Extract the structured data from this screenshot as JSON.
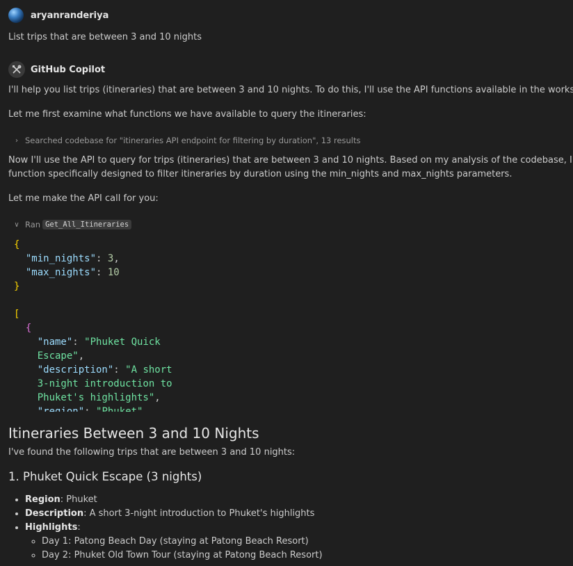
{
  "user": {
    "name": "aryanranderiya",
    "message": "List trips that are between 3 and 10 nights"
  },
  "copilot": {
    "name": "GitHub Copilot",
    "para1": "I'll help you list trips (itineraries) that are between 3 and 10 nights. To do this, I'll use the API functions available in the workspace.",
    "para2": "Let me first examine what functions we have available to query the itineraries:",
    "search_step": "Searched codebase for \"itineraries API endpoint for filtering by duration\", 13 results",
    "para3a": "Now I'll use the API to query for trips (itineraries) that are between 3 and 10 nights. Based on my analysis of the codebase, I can see there's a",
    "para3b": "function specifically designed to filter itineraries by duration using the min_nights and max_nights parameters.",
    "para4": "Let me make the API call for you:",
    "ran_label": "Ran",
    "tool_name": "Get_All_Itineraries",
    "input": {
      "min_key": "\"min_nights\"",
      "min_val": "3",
      "max_key": "\"max_nights\"",
      "max_val": "10"
    },
    "output": {
      "name_key": "\"name\"",
      "name_val_1": "\"Phuket Quick",
      "name_val_2": "Escape\"",
      "desc_key": "\"description\"",
      "desc_val_1": "\"A short",
      "desc_val_2": "3-night introduction to",
      "desc_val_3": "Phuket's highlights\"",
      "region_key": "\"region\"",
      "region_val": "\"Phuket\""
    },
    "heading": "Itineraries Between 3 and 10 Nights",
    "intro": "I've found the following trips that are between 3 and 10 nights:",
    "trip_title": "1. Phuket Quick Escape (3 nights)",
    "details": {
      "region_label": "Region",
      "region_value": ": Phuket",
      "desc_label": "Description",
      "desc_value": ": A short 3-night introduction to Phuket's highlights",
      "highlights_label": "Highlights",
      "highlights_suffix": ":",
      "days": [
        "Day 1: Patong Beach Day (staying at Patong Beach Resort)",
        "Day 2: Phuket Old Town Tour (staying at Patong Beach Resort)"
      ]
    }
  }
}
